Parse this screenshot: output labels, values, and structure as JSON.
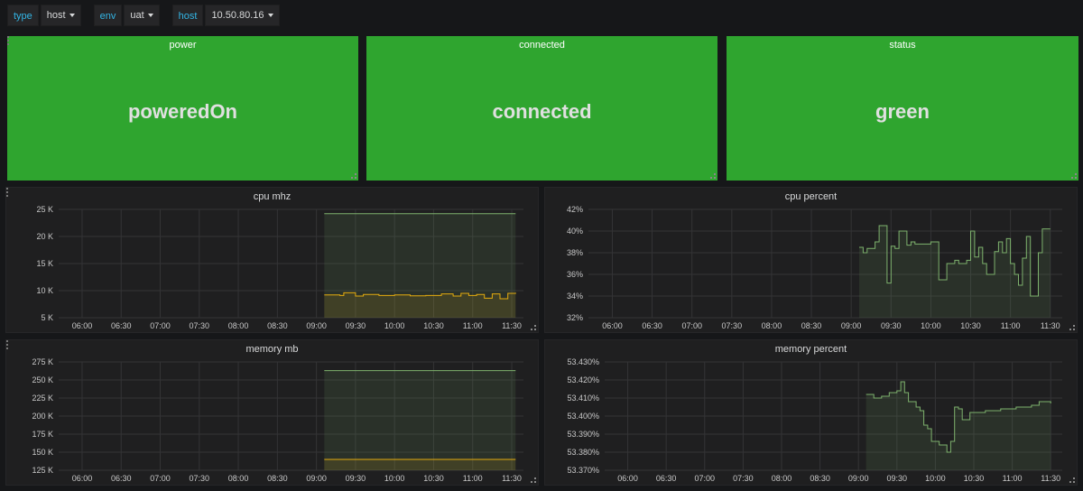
{
  "variables": [
    {
      "label": "type",
      "value": "host"
    },
    {
      "label": "env",
      "value": "uat"
    },
    {
      "label": "host",
      "value": "10.50.80.16"
    }
  ],
  "stats": [
    {
      "title": "power",
      "value": "poweredOn",
      "color": "#2fa52f"
    },
    {
      "title": "connected",
      "value": "connected",
      "color": "#2fa52f"
    },
    {
      "title": "status",
      "value": "green",
      "color": "#2fa52f"
    }
  ],
  "chart_data": [
    {
      "type": "line",
      "title": "cpu mhz",
      "x_ticks": [
        "06:00",
        "06:30",
        "07:00",
        "07:30",
        "08:00",
        "08:30",
        "09:00",
        "09:30",
        "10:00",
        "10:30",
        "11:00",
        "11:30"
      ],
      "y_ticks": [
        "5 K",
        "10 K",
        "15 K",
        "20 K",
        "25 K"
      ],
      "ylim": [
        5000,
        25000
      ],
      "xlim": [
        5.7,
        11.65
      ],
      "series": [
        {
          "color": "#7eb26d",
          "x": [
            9.1,
            11.55
          ],
          "values": [
            24200,
            24200
          ]
        },
        {
          "color": "#e5ac0e",
          "x": [
            9.1,
            9.3,
            9.35,
            9.5,
            9.6,
            9.8,
            10.0,
            10.2,
            10.4,
            10.6,
            10.75,
            10.85,
            10.95,
            11.05,
            11.15,
            11.25,
            11.35,
            11.45,
            11.55
          ],
          "values": [
            9200,
            9100,
            9600,
            9000,
            9300,
            9100,
            9200,
            9050,
            9100,
            9400,
            9000,
            9500,
            9100,
            9300,
            8600,
            9400,
            8500,
            9500,
            9600
          ]
        }
      ],
      "fill_from": 9.1
    },
    {
      "type": "line",
      "title": "cpu percent",
      "x_ticks": [
        "06:00",
        "06:30",
        "07:00",
        "07:30",
        "08:00",
        "08:30",
        "09:00",
        "09:30",
        "10:00",
        "10:30",
        "11:00",
        "11:30"
      ],
      "y_ticks": [
        "32%",
        "34%",
        "36%",
        "38%",
        "40%",
        "42%"
      ],
      "ylim": [
        32,
        42
      ],
      "xlim": [
        5.7,
        11.65
      ],
      "series": [
        {
          "color": "#7eb26d",
          "x": [
            9.1,
            9.15,
            9.2,
            9.3,
            9.35,
            9.45,
            9.5,
            9.55,
            9.6,
            9.7,
            9.75,
            9.8,
            9.9,
            10.0,
            10.1,
            10.2,
            10.3,
            10.35,
            10.45,
            10.5,
            10.55,
            10.6,
            10.65,
            10.7,
            10.8,
            10.85,
            10.9,
            10.95,
            11.0,
            11.05,
            11.1,
            11.15,
            11.2,
            11.25,
            11.3,
            11.35,
            11.4,
            11.45,
            11.5
          ],
          "values": [
            38.5,
            38,
            38.4,
            39,
            40.5,
            35.2,
            38.6,
            38.4,
            40,
            38.7,
            39,
            38.8,
            38.8,
            39,
            35.5,
            37,
            37.3,
            37,
            37.3,
            40,
            37.6,
            38.5,
            37,
            36,
            38.1,
            39,
            38,
            39.3,
            37,
            36,
            35,
            37.5,
            39.5,
            34,
            34,
            38,
            40.2,
            40.2,
            40.2
          ]
        }
      ],
      "fill_from": 9.1
    },
    {
      "type": "line",
      "title": "memory mb",
      "x_ticks": [
        "06:00",
        "06:30",
        "07:00",
        "07:30",
        "08:00",
        "08:30",
        "09:00",
        "09:30",
        "10:00",
        "10:30",
        "11:00",
        "11:30"
      ],
      "y_ticks": [
        "125 K",
        "150 K",
        "175 K",
        "200 K",
        "225 K",
        "250 K",
        "275 K"
      ],
      "ylim": [
        125000,
        275000
      ],
      "xlim": [
        5.7,
        11.65
      ],
      "series": [
        {
          "color": "#7eb26d",
          "x": [
            9.1,
            11.55
          ],
          "values": [
            263000,
            263000
          ]
        },
        {
          "color": "#e5ac0e",
          "x": [
            9.1,
            11.55
          ],
          "values": [
            140000,
            140000
          ]
        }
      ],
      "fill_from": 9.1
    },
    {
      "type": "line",
      "title": "memory percent",
      "x_ticks": [
        "06:00",
        "06:30",
        "07:00",
        "07:30",
        "08:00",
        "08:30",
        "09:00",
        "09:30",
        "10:00",
        "10:30",
        "11:00",
        "11:30"
      ],
      "y_ticks": [
        "53.370%",
        "53.380%",
        "53.390%",
        "53.400%",
        "53.410%",
        "53.420%",
        "53.430%"
      ],
      "ylim": [
        53.37,
        53.43
      ],
      "xlim": [
        5.7,
        11.65
      ],
      "series": [
        {
          "color": "#7eb26d",
          "x": [
            9.1,
            9.15,
            9.2,
            9.3,
            9.4,
            9.5,
            9.55,
            9.6,
            9.65,
            9.75,
            9.8,
            9.85,
            9.9,
            9.95,
            10.0,
            10.05,
            10.1,
            10.15,
            10.2,
            10.25,
            10.3,
            10.35,
            10.45,
            10.55,
            10.65,
            10.75,
            10.85,
            10.95,
            11.05,
            11.15,
            11.25,
            11.35,
            11.45,
            11.5
          ],
          "values": [
            53.412,
            53.412,
            53.41,
            53.411,
            53.413,
            53.414,
            53.419,
            53.413,
            53.408,
            53.405,
            53.403,
            53.395,
            53.393,
            53.386,
            53.386,
            53.384,
            53.384,
            53.38,
            53.386,
            53.405,
            53.404,
            53.398,
            53.402,
            53.402,
            53.403,
            53.403,
            53.404,
            53.404,
            53.405,
            53.405,
            53.406,
            53.408,
            53.408,
            53.407
          ]
        }
      ],
      "fill_from": 9.1
    }
  ]
}
